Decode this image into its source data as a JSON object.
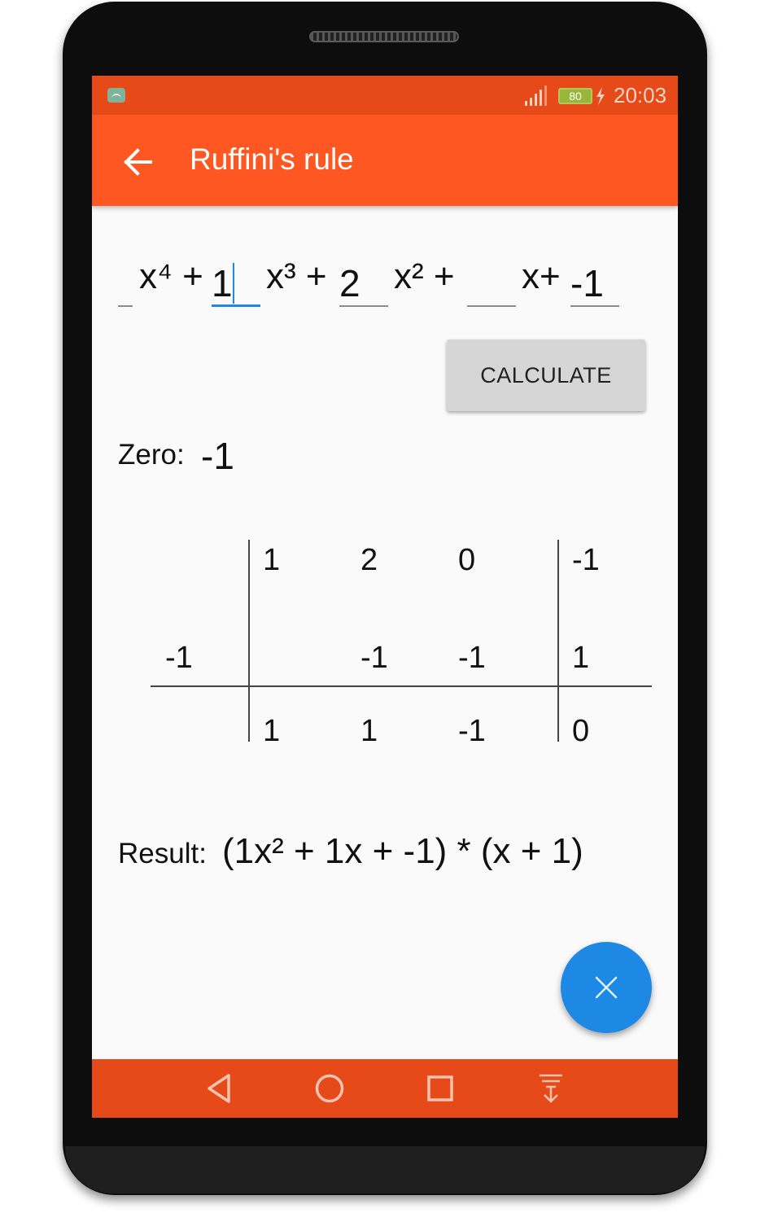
{
  "status_bar": {
    "battery": "80",
    "time": "20:03",
    "icons": [
      "android-debug-icon",
      "signal-icon",
      "battery-icon",
      "charging-icon"
    ]
  },
  "app_bar": {
    "title": "Ruffini's rule",
    "back_icon": "arrow-back-icon"
  },
  "polynomial": {
    "coefficients": [
      {
        "value": "",
        "placeholder": "",
        "term": "x⁴ +"
      },
      {
        "value": "1",
        "placeholder": "",
        "term": "x³ +",
        "focused": true
      },
      {
        "value": "2",
        "placeholder": "",
        "term": "x² +"
      },
      {
        "value": "",
        "placeholder": "",
        "term": "x+"
      },
      {
        "value": "-1",
        "placeholder": ""
      }
    ]
  },
  "calculate_button": {
    "label": "CALCULATE"
  },
  "zero": {
    "label": "Zero:",
    "value": "-1"
  },
  "ruffini": {
    "divisor": "-1",
    "top_row": [
      "1",
      "2",
      "0",
      "-1"
    ],
    "middle_row": [
      "",
      "-1",
      "-1",
      "1"
    ],
    "bottom_row": [
      "1",
      "1",
      "-1",
      "0"
    ]
  },
  "result": {
    "label": "Result:",
    "value": "(1x² + 1x + -1) * (x + 1)"
  },
  "fab": {
    "icon": "close-icon"
  },
  "nav_bar": {
    "buttons": [
      "back-triangle-icon",
      "home-circle-icon",
      "recents-square-icon",
      "notification-pull-icon"
    ]
  },
  "colors": {
    "status_bar": "#e64a19",
    "app_bar": "#ff5722",
    "fab": "#1e88e5",
    "focus": "#1e88e5"
  }
}
